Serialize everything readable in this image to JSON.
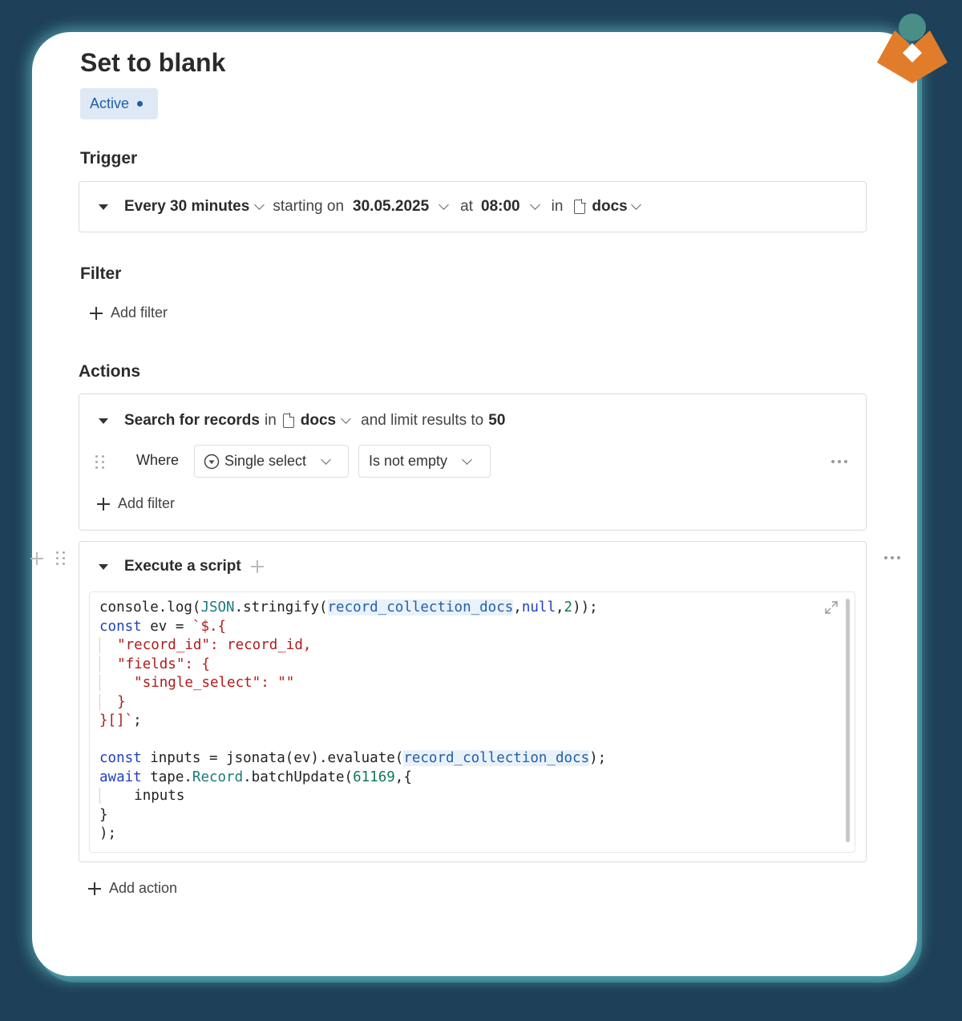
{
  "automation": {
    "title": "Set to blank",
    "status": "Active"
  },
  "trigger": {
    "heading": "Trigger",
    "interval": "Every 30 minutes",
    "starting_label": "starting on",
    "start_date": "30.05.2025",
    "at_label": "at",
    "time": "08:00",
    "in_label": "in",
    "table": "docs"
  },
  "filter": {
    "heading": "Filter",
    "add_label": "Add filter"
  },
  "actions": {
    "heading": "Actions",
    "search": {
      "label": "Search for records",
      "in_label": "in",
      "table": "docs",
      "limit_label": "and limit results to",
      "limit": "50",
      "where_label": "Where",
      "field": "Single select",
      "operator": "Is not empty",
      "add_filter_label": "Add filter"
    },
    "script": {
      "label": "Execute a script",
      "lines": [
        "console.log(JSON.stringify(record_collection_docs,null,2));",
        "const ev = `$.{",
        "\"record_id\": record_id,",
        "\"fields\": {",
        "\"single_select\": \"\"",
        "}",
        "}[]`;",
        "const inputs = jsonata(ev).evaluate(record_collection_docs);",
        "await tape.Record.batchUpdate(61169,{",
        "inputs",
        "}",
        ");"
      ]
    },
    "add_action_label": "Add action"
  },
  "colors": {
    "background": "#1e4058",
    "accent": "#1f5fa8",
    "logo_orange": "#e07c2a",
    "logo_teal": "#4a8f87"
  }
}
